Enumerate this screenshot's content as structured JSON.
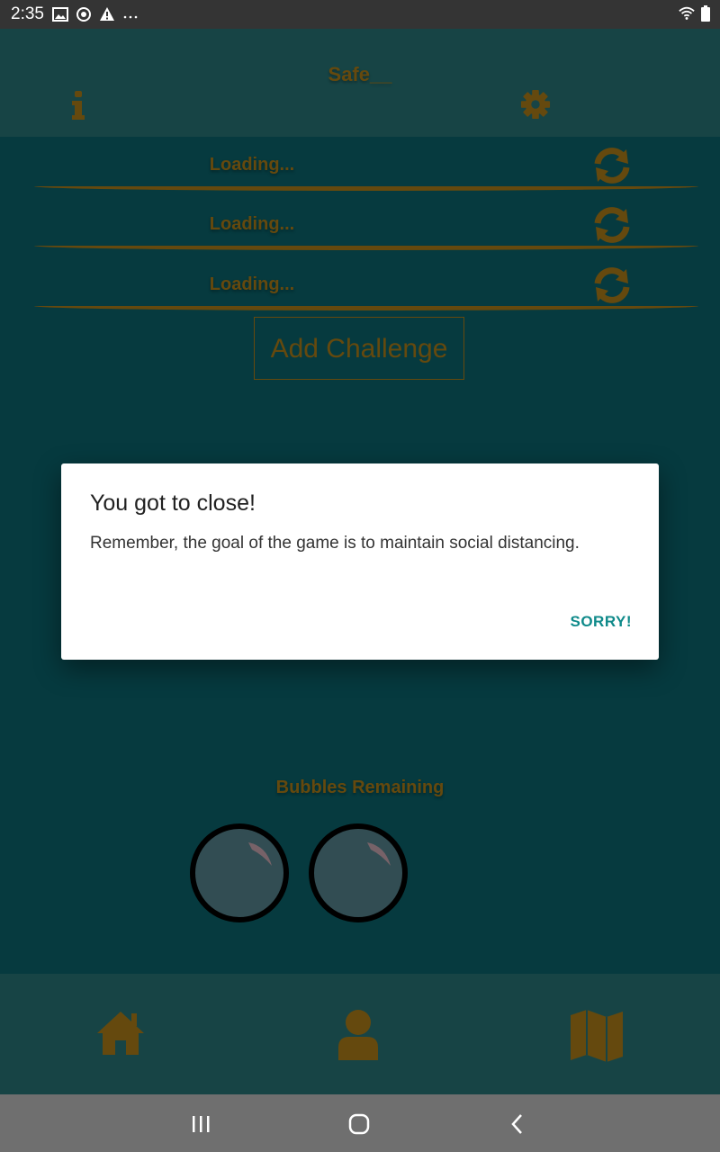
{
  "status_bar": {
    "time": "2:35",
    "left_icons": [
      "image-icon",
      "sync-icon",
      "warning-icon",
      "more-icon"
    ],
    "right_icons": [
      "wifi-icon",
      "battery-icon"
    ]
  },
  "header": {
    "title": "Safe__",
    "left_icon": "info-icon",
    "right_icon": "gear-icon"
  },
  "challenges": [
    {
      "text": "Loading...",
      "icon": "refresh-icon"
    },
    {
      "text": "Loading...",
      "icon": "refresh-icon"
    },
    {
      "text": "Loading...",
      "icon": "refresh-icon"
    }
  ],
  "add_challenge_label": "Add Challenge",
  "bubbles": {
    "label": "Bubbles Remaining",
    "count": 2
  },
  "bottom_nav": {
    "items": [
      {
        "name": "home",
        "icon": "home-icon"
      },
      {
        "name": "profile",
        "icon": "user-icon"
      },
      {
        "name": "map",
        "icon": "map-icon"
      }
    ]
  },
  "dialog": {
    "title": "You got to close!",
    "message": "Remember, the goal of the game is to maintain social distancing.",
    "button_label": "SORRY!"
  },
  "colors": {
    "background": "#0b6a73",
    "header": "#2a7d7f",
    "accent": "#b8861a",
    "dialog_button": "#0f8a8a"
  }
}
